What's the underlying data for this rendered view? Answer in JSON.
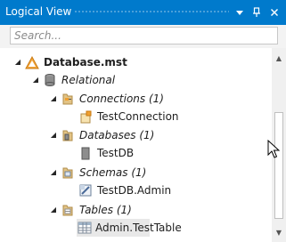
{
  "panel": {
    "title": "Logical View",
    "title_buttons": {
      "dropdown": "▾",
      "pin": "📌",
      "close": "✕"
    }
  },
  "search": {
    "placeholder": "Search..."
  },
  "tree": {
    "root": {
      "label": "Database.mst",
      "icon": "database-file-icon",
      "expanded": true
    },
    "relational": {
      "label": "Relational",
      "icon": "relational-icon",
      "expanded": true
    },
    "connections": {
      "label": "Connections (1)",
      "icon": "connections-folder-icon",
      "expanded": true
    },
    "test_connection": {
      "label": "TestConnection",
      "icon": "connection-icon"
    },
    "databases": {
      "label": "Databases (1)",
      "icon": "databases-folder-icon",
      "expanded": true
    },
    "test_db": {
      "label": "TestDB",
      "icon": "database-icon"
    },
    "schemas": {
      "label": "Schemas (1)",
      "icon": "schemas-folder-icon",
      "expanded": true
    },
    "test_db_admin": {
      "label": "TestDB.Admin",
      "icon": "schema-icon"
    },
    "tables": {
      "label": "Tables (1)",
      "icon": "tables-folder-icon",
      "expanded": true
    },
    "admin_test_table": {
      "label": "Admin.TestTable",
      "icon": "table-icon",
      "selected": true
    }
  },
  "colors": {
    "titlebar": "#007acc",
    "accent_orange": "#f0a030",
    "folder": "#d9b66b"
  }
}
